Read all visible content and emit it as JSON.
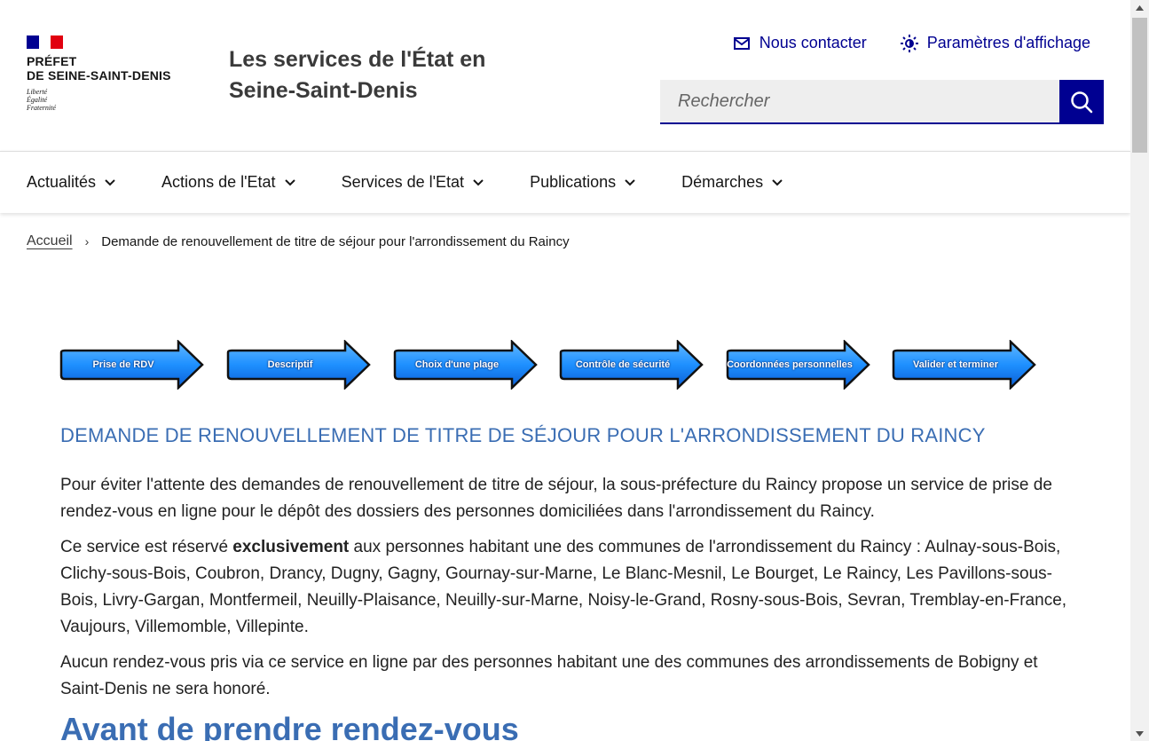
{
  "header": {
    "prefet_line1": "PRÉFET",
    "prefet_line2": "DE SEINE-SAINT-DENIS",
    "devise": [
      "Liberté",
      "Égalité",
      "Fraternité"
    ],
    "site_title": "Les services de l'État en Seine-Saint-Denis",
    "contact_label": "Nous contacter",
    "display_settings_label": "Paramètres d'affichage",
    "search_placeholder": "Rechercher"
  },
  "nav": {
    "items": [
      "Actualités",
      "Actions de l'Etat",
      "Services de l'Etat",
      "Publications",
      "Démarches"
    ]
  },
  "breadcrumb": {
    "home": "Accueil",
    "current": "Demande de renouvellement de titre de séjour pour l'arrondissement du Raincy"
  },
  "steps": [
    "Prise de RDV",
    "Descriptif",
    "Choix d'une plage",
    "Contrôle de sécurité",
    "Coordonnées personnelles",
    "Valider et terminer"
  ],
  "content": {
    "heading": "DEMANDE DE RENOUVELLEMENT DE TITRE DE SÉJOUR POUR L'ARRONDISSEMENT DU RAINCY",
    "p1": "Pour éviter l'attente des demandes de renouvellement de titre de séjour, la sous-préfecture du Raincy propose un service de prise de rendez-vous en ligne pour le dépôt des dossiers des personnes domiciliées dans l'arrondissement du Raincy.",
    "p2_before": "Ce service est réservé ",
    "p2_bold": "exclusivement",
    "p2_after": " aux personnes habitant une des communes de l'arrondissement du Raincy : Aulnay-sous-Bois, Clichy-sous-Bois, Coubron, Drancy, Dugny, Gagny, Gournay-sur-Marne, Le Blanc-Mesnil, Le Bourget, Le Raincy, Les Pavillons-sous-Bois, Livry-Gargan, Montfermeil, Neuilly-Plaisance, Neuilly-sur-Marne, Noisy-le-Grand, Rosny-sous-Bois, Sevran, Tremblay-en-France, Vaujours, Villemomble, Villepinte.",
    "p3": "Aucun rendez-vous pris via ce service en ligne par des personnes habitant une des communes des arrondissements de Bobigny et Saint-Denis ne sera honoré.",
    "subheading": "Avant de prendre rendez-vous"
  },
  "colors": {
    "brand_blue": "#000091",
    "heading_blue": "#3a6db3",
    "arrow_blue": "#1e90ff"
  }
}
